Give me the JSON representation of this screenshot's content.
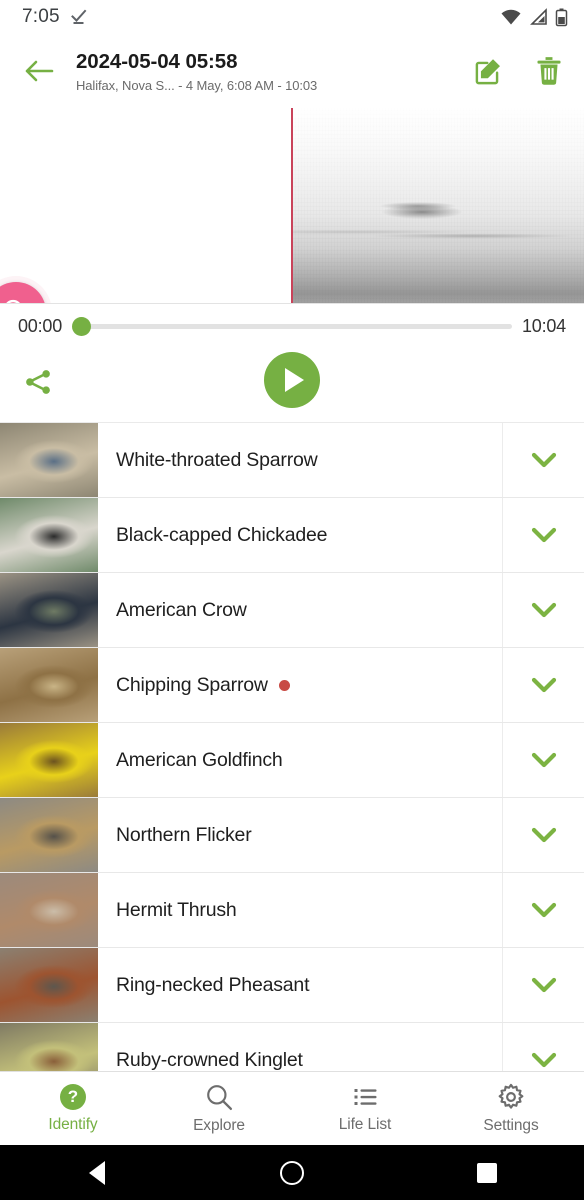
{
  "status_bar": {
    "time": "7:05",
    "icons": [
      "checkmark-underline-icon",
      "wifi-icon",
      "cell-signal-icon",
      "battery-icon"
    ]
  },
  "header": {
    "back_icon": "arrow-left-icon",
    "title": "2024-05-04 05:58",
    "subtitle": "Halifax, Nova S... - 4 May, 6:08 AM - 10:03",
    "edit_icon": "edit-pencil-icon",
    "delete_icon": "trash-icon",
    "accent_color": "#76b043"
  },
  "spectrogram": {
    "zoom_fab_icon": "zoom-in-icon",
    "zoom_fab_color": "#f0608e",
    "playhead_color": "#c9435a"
  },
  "player": {
    "current_time": "00:00",
    "total_time": "10:04",
    "progress_percent": 0,
    "share_icon": "share-icon",
    "play_icon": "play-icon",
    "accent_color": "#76b043"
  },
  "birds": [
    {
      "name": "White-throated Sparrow",
      "new": false,
      "chevron_icon": "chevron-down-icon",
      "thumb_colors": [
        "#8d8673",
        "#c9bda4",
        "#5a6f86"
      ]
    },
    {
      "name": "Black-capped Chickadee",
      "new": false,
      "chevron_icon": "chevron-down-icon",
      "thumb_colors": [
        "#6f8a6a",
        "#d9d6cd",
        "#2b2b2b"
      ]
    },
    {
      "name": "American Crow",
      "new": false,
      "chevron_icon": "chevron-down-icon",
      "thumb_colors": [
        "#9b9384",
        "#2c3542",
        "#6f7b64"
      ]
    },
    {
      "name": "Chipping Sparrow",
      "new": true,
      "chevron_icon": "chevron-down-icon",
      "thumb_colors": [
        "#b8a079",
        "#8e7145",
        "#c9b486"
      ]
    },
    {
      "name": "American Goldfinch",
      "new": false,
      "chevron_icon": "chevron-down-icon",
      "thumb_colors": [
        "#9a7b3a",
        "#e8d11a",
        "#6b5220"
      ]
    },
    {
      "name": "Northern Flicker",
      "new": false,
      "chevron_icon": "chevron-down-icon",
      "thumb_colors": [
        "#8d8a83",
        "#b99a63",
        "#55514a"
      ]
    },
    {
      "name": "Hermit Thrush",
      "new": false,
      "chevron_icon": "chevron-down-icon",
      "thumb_colors": [
        "#9c8a7c",
        "#b08a6a",
        "#cbbda9"
      ]
    },
    {
      "name": "Ring-necked Pheasant",
      "new": false,
      "chevron_icon": "chevron-down-icon",
      "thumb_colors": [
        "#8b8071",
        "#9d5430",
        "#5d574e"
      ]
    },
    {
      "name": "Ruby-crowned Kinglet",
      "new": false,
      "chevron_icon": "chevron-down-icon",
      "thumb_colors": [
        "#7f7a63",
        "#c3c07a",
        "#8a5f3a"
      ]
    }
  ],
  "bottom_nav": {
    "items": [
      {
        "label": "Identify",
        "icon": "question-mark-circle-icon",
        "active": true
      },
      {
        "label": "Explore",
        "icon": "search-icon",
        "active": false
      },
      {
        "label": "Life List",
        "icon": "list-icon",
        "active": false
      },
      {
        "label": "Settings",
        "icon": "gear-icon",
        "active": false
      }
    ],
    "active_color": "#76b043",
    "inactive_color": "#6d6d6d"
  },
  "android_nav": {
    "back": "back-triangle-icon",
    "home": "home-circle-icon",
    "recents": "recents-square-icon"
  }
}
